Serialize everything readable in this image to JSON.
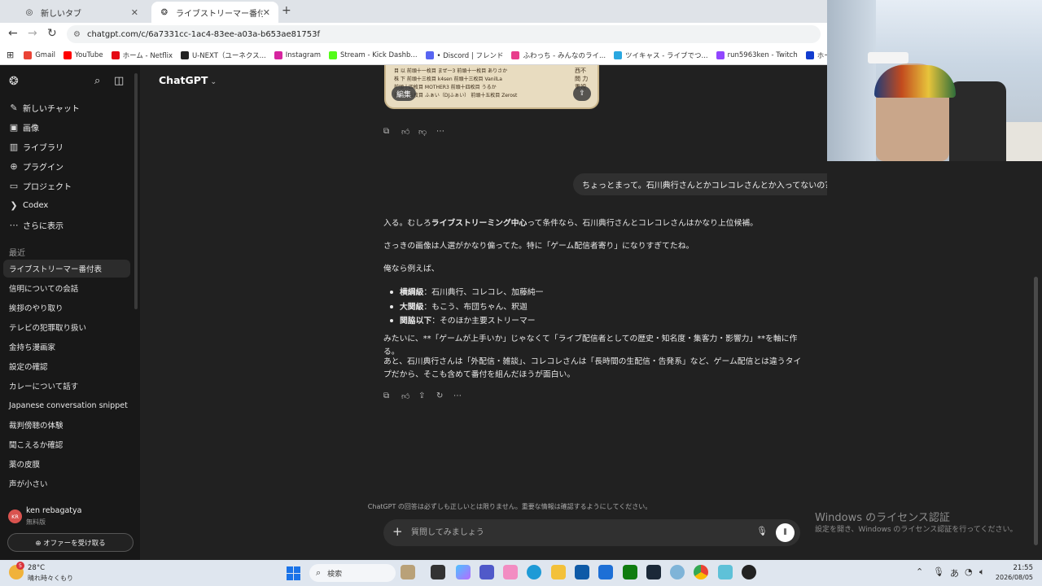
{
  "browser": {
    "tabs": [
      {
        "label": "新しいタブ",
        "close": "✕"
      },
      {
        "label": "ライブストリーマー番付表",
        "close": "✕"
      }
    ],
    "new_tab": "+",
    "url": "chatgpt.com/c/6a7331cc-1ac4-83ee-a03a-b653ae81753f",
    "bookmarks": [
      {
        "label": "Gmail",
        "color": "#ea4335"
      },
      {
        "label": "YouTube",
        "color": "#ff0000"
      },
      {
        "label": "ホーム - Netflix",
        "color": "#e50914"
      },
      {
        "label": "U-NEXT（ユーネクス...",
        "color": "#222222"
      },
      {
        "label": "Instagram",
        "color": "#d6249f"
      },
      {
        "label": "Stream - Kick Dashb...",
        "color": "#53fc18"
      },
      {
        "label": "• Discord | フレンド",
        "color": "#5865f2"
      },
      {
        "label": "ふわっち - みんなのライ...",
        "color": "#e83e8c"
      },
      {
        "label": "ツイキャス - ライブでつ...",
        "color": "#2aa7e0"
      },
      {
        "label": "run5963ken - Twitch",
        "color": "#9146ff"
      },
      {
        "label": "ホーム | Disney+(ディ...",
        "color": "#113ccf"
      },
      {
        "label": "ニコニコ",
        "color": "#252525"
      }
    ]
  },
  "sidebar": {
    "nav": [
      {
        "icon": "✎",
        "label": "新しいチャット"
      },
      {
        "icon": "▣",
        "label": "画像"
      },
      {
        "icon": "▥",
        "label": "ライブラリ"
      },
      {
        "icon": "⊕",
        "label": "プラグイン"
      },
      {
        "icon": "▭",
        "label": "プロジェクト"
      },
      {
        "icon": "❯",
        "label": "Codex"
      },
      {
        "icon": "⋯",
        "label": "さらに表示"
      }
    ],
    "recent_label": "最近",
    "chats": [
      "ライブストリーマー番付表",
      "信明についての会話",
      "挨拶のやり取り",
      "テレビの犯罪取り扱い",
      "金持ち漫画家",
      "設定の確認",
      "カレーについて話す",
      "Japanese conversation snippet",
      "裁判傍聴の体験",
      "聞こえるか確認",
      "薬の皮膜",
      "声が小さい"
    ],
    "user": {
      "initials": "KR",
      "name": "ken rebagatya",
      "plan": "無料版"
    },
    "offer_button": "⊕ オファーを受け取る"
  },
  "main": {
    "model": "ChatGPT",
    "image_card": {
      "lines": [
        "目  以    前頭十一枚目  まぜ一3      前頭十一枚目  ありさか",
        "株  下    前頭十三枚目  k4sen        前頭十三枚目  VanilLa",
        "          前頭十四枚目  MOTHER3      前頭十四枚目  うるか",
        "          前頭十五枚目  ふぁい（DJふぁい）  前頭十五枚目  Zerost"
      ],
      "edit_label": "編集",
      "side_text": "西不問 力重視"
    },
    "user_message": "ちょっとまって。石川典行さんとかコレコレさんとか入ってないの？",
    "assistant": {
      "p1_prefix": "入る。むしろ",
      "p1_bold": "ライブストリーミング中心",
      "p1_suffix": "って条件なら、石川典行さんとコレコレさんはかなり上位候補。",
      "p2": "さっきの画像は人選がかなり偏ってた。特に「ゲーム配信者寄り」になりすぎてたね。",
      "p3": "俺なら例えば、",
      "list": [
        {
          "bold": "横綱級",
          "text": "：石川典行、コレコレ、加藤純一"
        },
        {
          "bold": "大関級",
          "text": "：もこう、布団ちゃん、釈迦"
        },
        {
          "bold": "関脇以下",
          "text": "：そのほか主要ストリーマー"
        }
      ],
      "p4": "みたいに、**「ゲームが上手いか」じゃなくて「ライブ配信者としての歴史・知名度・集客力・影響力」**を軸に作る。",
      "p5": "あと、石川典行さんは「外配信・雑談」、コレコレさんは「長時間の生配信・告発系」など、ゲーム配信とは違うタイプだから、そこも含めて番付を組んだほうが面白い。"
    },
    "disclaimer": "ChatGPT の回答は必ずしも正しいとは限りません。重要な情報は確認するようにしてください。",
    "composer_placeholder": "質問してみましょう"
  },
  "windows": {
    "watermark_title": "Windows のライセンス認証",
    "watermark_sub": "設定を開き、Windows のライセンス認証を行ってください。",
    "weather_temp": "28°C",
    "weather_desc": "晴れ時々くもり",
    "weather_badge": "5",
    "search": "検索",
    "time": "21:55",
    "date": "2026/08/05",
    "ime": "あ"
  }
}
